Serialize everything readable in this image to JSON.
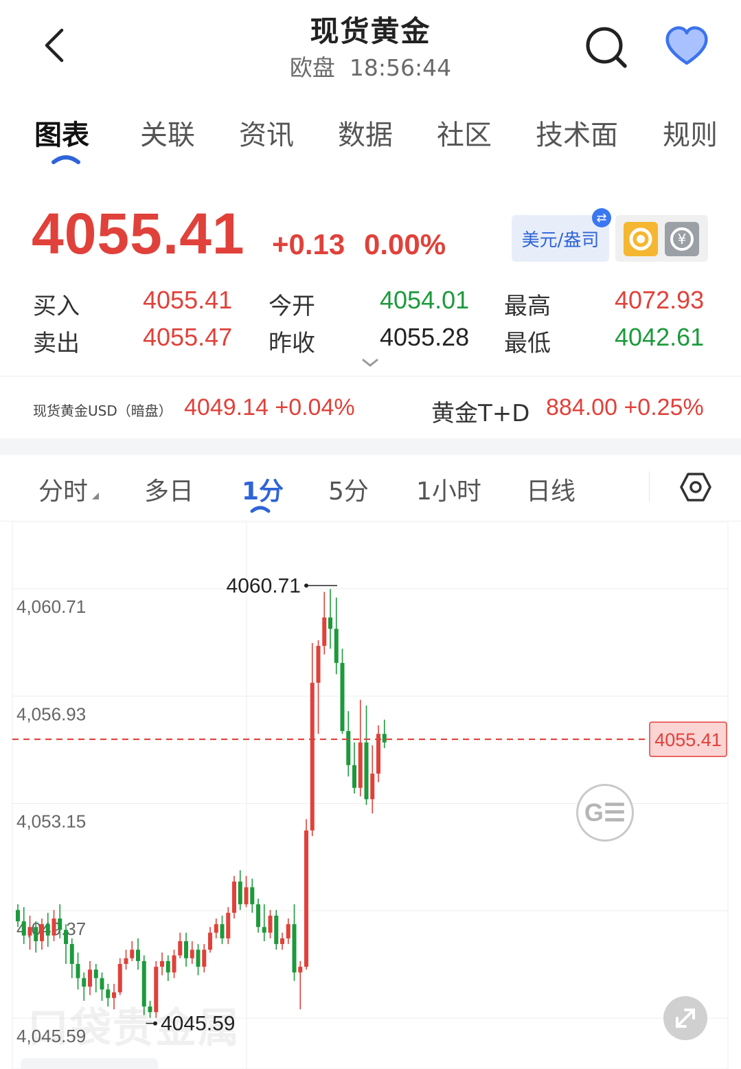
{
  "header": {
    "title": "现货黄金",
    "session": "欧盘",
    "time": "18:56:44"
  },
  "tabs": [
    {
      "label": "图表",
      "active": true
    },
    {
      "label": "关联"
    },
    {
      "label": "资讯"
    },
    {
      "label": "数据"
    },
    {
      "label": "社区"
    },
    {
      "label": "技术面"
    },
    {
      "label": "规则"
    }
  ],
  "quote": {
    "price": "4055.41",
    "change": "+0.13",
    "change_pct": "0.00%",
    "currency_label": "美元/盎司",
    "stats": {
      "buy_label": "买入",
      "buy": "4055.41",
      "sell_label": "卖出",
      "sell": "4055.47",
      "open_label": "今开",
      "open": "4054.01",
      "prev_close_label": "昨收",
      "prev_close": "4055.28",
      "high_label": "最高",
      "high": "4072.93",
      "low_label": "最低",
      "low": "4042.61"
    }
  },
  "related": {
    "item1_label": "现货黄金USD（暗盘）",
    "item1_value": "4049.14 +0.04%",
    "item2_label": "黄金T+D",
    "item2_value": "884.00 +0.25%"
  },
  "periods": [
    {
      "label": "分时"
    },
    {
      "label": "多日"
    },
    {
      "label": "1分",
      "active": true
    },
    {
      "label": "5分"
    },
    {
      "label": "1小时"
    },
    {
      "label": "日线"
    }
  ],
  "chart_data": {
    "type": "candlestick",
    "y_ticks": [
      "4,060.71",
      "4,056.93",
      "4,053.15",
      "4,049.37",
      "4,045.59"
    ],
    "ylim": [
      4045.59,
      4060.71
    ],
    "max_label": "4060.71",
    "min_label": "4045.59",
    "last_price_label": "4055.41",
    "last_price": 4055.41,
    "up_color": "#e0413a",
    "down_color": "#1c9a3c",
    "candles": [
      [
        4049.4,
        4049.0,
        4049.6,
        4048.8
      ],
      [
        4049.0,
        4048.5,
        4049.5,
        4048.2
      ],
      [
        4048.5,
        4048.8,
        4049.2,
        4048.0
      ],
      [
        4048.8,
        4048.3,
        4049.0,
        4047.9
      ],
      [
        4048.3,
        4048.9,
        4049.1,
        4048.0
      ],
      [
        4048.9,
        4048.5,
        4049.3,
        4048.1
      ],
      [
        4048.5,
        4049.1,
        4049.4,
        4048.3
      ],
      [
        4049.1,
        4048.7,
        4049.6,
        4048.4
      ],
      [
        4048.7,
        4048.2,
        4048.9,
        4047.5
      ],
      [
        4048.2,
        4047.5,
        4048.4,
        4047.0
      ],
      [
        4047.5,
        4047.0,
        4047.9,
        4046.6
      ],
      [
        4047.0,
        4046.7,
        4047.2,
        4046.2
      ],
      [
        4046.7,
        4047.3,
        4047.6,
        4046.4
      ],
      [
        4047.3,
        4047.0,
        4047.5,
        4046.5
      ],
      [
        4047.0,
        4046.6,
        4047.2,
        4046.2
      ],
      [
        4046.6,
        4046.3,
        4046.8,
        4046.0
      ],
      [
        4046.3,
        4046.5,
        4046.8,
        4045.9
      ],
      [
        4046.5,
        4047.5,
        4047.7,
        4046.4
      ],
      [
        4047.5,
        4047.7,
        4048.0,
        4047.3
      ],
      [
        4047.7,
        4048.0,
        4048.3,
        4047.6
      ],
      [
        4048.0,
        4047.6,
        4048.4,
        4047.3
      ],
      [
        4047.6,
        4046.0,
        4047.8,
        4045.7
      ],
      [
        4046.0,
        4045.8,
        4046.2,
        4045.6
      ],
      [
        4045.8,
        4047.4,
        4047.6,
        4045.6
      ],
      [
        4047.4,
        4047.6,
        4047.9,
        4047.1
      ],
      [
        4047.6,
        4047.2,
        4047.8,
        4046.9
      ],
      [
        4047.2,
        4047.8,
        4048.0,
        4047.0
      ],
      [
        4047.8,
        4048.3,
        4048.6,
        4047.7
      ],
      [
        4048.3,
        4047.7,
        4048.6,
        4047.4
      ],
      [
        4047.7,
        4048.0,
        4048.3,
        4047.5
      ],
      [
        4048.0,
        4047.4,
        4048.2,
        4047.1
      ],
      [
        4047.4,
        4048.0,
        4048.2,
        4047.2
      ],
      [
        4048.0,
        4048.6,
        4048.8,
        4047.9
      ],
      [
        4048.6,
        4048.9,
        4049.1,
        4048.4
      ],
      [
        4048.9,
        4048.4,
        4049.2,
        4048.2
      ],
      [
        4048.4,
        4049.3,
        4049.5,
        4048.2
      ],
      [
        4049.3,
        4050.4,
        4050.6,
        4049.1
      ],
      [
        4050.4,
        4049.6,
        4050.8,
        4049.4
      ],
      [
        4049.6,
        4050.2,
        4050.6,
        4049.5
      ],
      [
        4050.2,
        4049.6,
        4050.5,
        4049.3
      ],
      [
        4049.6,
        4048.8,
        4049.8,
        4048.6
      ],
      [
        4048.8,
        4048.6,
        4049.6,
        4048.3
      ],
      [
        4048.6,
        4049.2,
        4049.4,
        4048.4
      ],
      [
        4049.2,
        4048.2,
        4049.4,
        4048.0
      ],
      [
        4048.2,
        4048.4,
        4048.6,
        4048.0
      ],
      [
        4048.4,
        4048.9,
        4049.1,
        4048.2
      ],
      [
        4048.9,
        4047.2,
        4049.6,
        4046.9
      ],
      [
        4047.2,
        4047.4,
        4047.6,
        4045.9
      ],
      [
        4047.4,
        4052.2,
        4052.6,
        4047.3
      ],
      [
        4052.2,
        4057.4,
        4058.8,
        4052.0
      ],
      [
        4057.4,
        4058.7,
        4058.9,
        4055.6
      ],
      [
        4058.7,
        4059.7,
        4060.6,
        4058.4
      ],
      [
        4059.7,
        4059.3,
        4060.7,
        4058.6
      ],
      [
        4059.3,
        4058.1,
        4060.4,
        4057.7
      ],
      [
        4058.1,
        4055.7,
        4058.6,
        4055.6
      ],
      [
        4055.7,
        4054.5,
        4056.4,
        4054.1
      ],
      [
        4054.5,
        4053.7,
        4055.3,
        4053.5
      ],
      [
        4053.7,
        4055.3,
        4056.8,
        4053.4
      ],
      [
        4055.3,
        4053.3,
        4056.6,
        4053.1
      ],
      [
        4053.3,
        4054.2,
        4055.2,
        4052.8
      ],
      [
        4054.2,
        4055.6,
        4055.9,
        4053.9
      ],
      [
        4055.6,
        4055.3,
        4056.1,
        4055.1
      ]
    ]
  }
}
